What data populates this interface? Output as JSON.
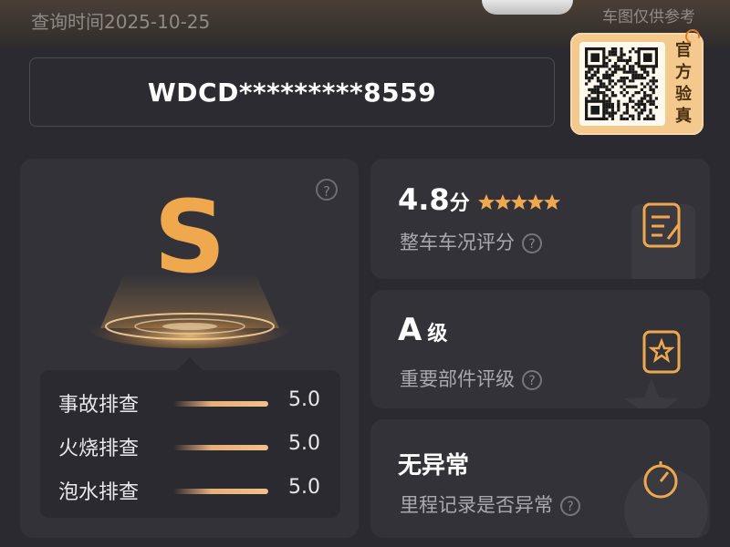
{
  "header": {
    "query_time": "查询时间2025-10-25",
    "car_note": "车图仅供参考"
  },
  "vin": "WDCD*********8559",
  "qr": {
    "label_chars": [
      "官",
      "方",
      "验",
      "真"
    ]
  },
  "grade": {
    "letter": "S",
    "help": "?"
  },
  "checks": [
    {
      "label": "事故排查",
      "score": "5.0",
      "level": 1.0
    },
    {
      "label": "火烧排查",
      "score": "5.0",
      "level": 1.0
    },
    {
      "label": "泡水排查",
      "score": "5.0",
      "level": 1.0
    }
  ],
  "cards": {
    "overall": {
      "value": "4.8",
      "unit": "分",
      "label": "整车车况评分",
      "stars": 5,
      "icon": "document-edit-icon"
    },
    "parts": {
      "value": "A",
      "unit": "级",
      "label": "重要部件评级",
      "icon": "star-document-icon"
    },
    "mileage": {
      "value": "无异常",
      "label": "里程记录是否异常",
      "icon": "gauge-icon"
    }
  },
  "colors": {
    "accent": "#f0a84e",
    "background": "#2a2a30",
    "card": "#323238",
    "qr_card": "#f3c98e"
  }
}
